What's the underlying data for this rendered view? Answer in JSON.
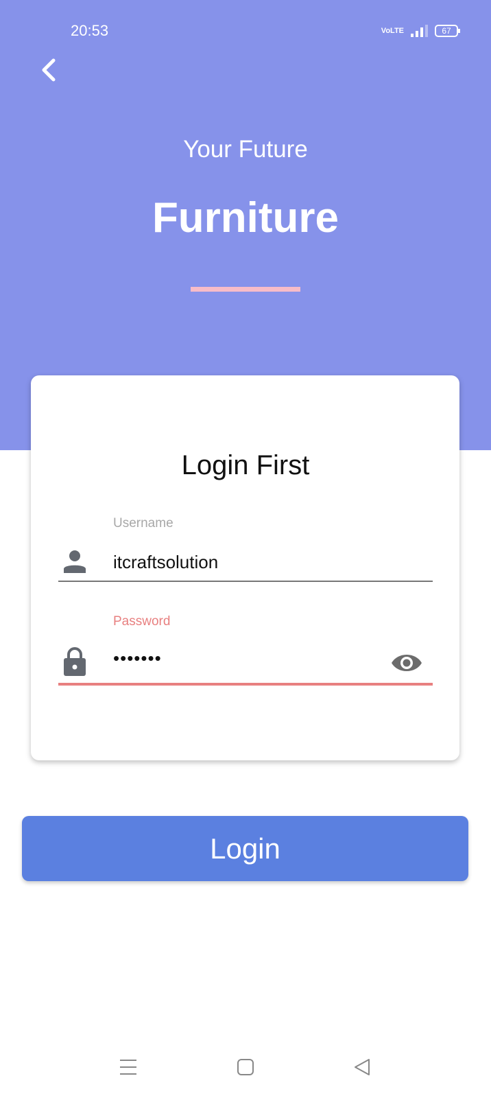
{
  "status_bar": {
    "time": "20:53",
    "network": "VoLTE",
    "battery": "67"
  },
  "header": {
    "subtitle": "Your Future",
    "title": "Furniture",
    "accent_color": "#f7bcc8",
    "bg_color": "#8692ea"
  },
  "card": {
    "title": "Login First",
    "username": {
      "label": "Username",
      "value": "itcraftsolution",
      "icon": "person-icon"
    },
    "password": {
      "label": "Password",
      "value": "•••••••",
      "icon": "lock-icon",
      "toggle_icon": "eye-icon",
      "error_color": "#e88080"
    }
  },
  "login_button": {
    "label": "Login",
    "color": "#5b80e0"
  },
  "nav_bar": {
    "icons": [
      "menu-icon",
      "home-icon",
      "back-icon"
    ]
  }
}
